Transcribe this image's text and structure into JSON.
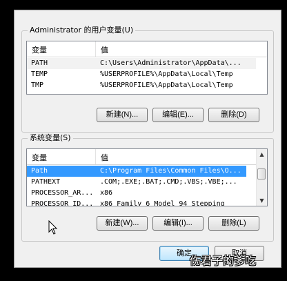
{
  "user_vars": {
    "title": "Administrator 的用户变量(U)",
    "headers": [
      "变量",
      "值"
    ],
    "rows": [
      {
        "name": "PATH",
        "value": "C:\\Users\\Administrator\\AppData\\..."
      },
      {
        "name": "TEMP",
        "value": "%USERPROFILE%\\AppData\\Local\\Temp"
      },
      {
        "name": "TMP",
        "value": "%USERPROFILE%\\AppData\\Local\\Temp"
      }
    ],
    "buttons": {
      "new": "新建(N)...",
      "edit": "编辑(E)...",
      "delete": "删除(D)"
    }
  },
  "system_vars": {
    "title": "系统变量(S)",
    "headers": [
      "变量",
      "值"
    ],
    "rows": [
      {
        "name": "Path",
        "value": "C:\\Program Files\\Common Files\\O..."
      },
      {
        "name": "PATHEXT",
        "value": ".COM;.EXE;.BAT;.CMD;.VBS;.VBE;..."
      },
      {
        "name": "PROCESSOR_AR...",
        "value": "x86"
      },
      {
        "name": "PROCESSOR_ID...",
        "value": "x86 Family 6 Model 94 Stepping"
      }
    ],
    "buttons": {
      "new": "新建(W)...",
      "edit": "编辑(I)...",
      "delete": "删除(L)"
    }
  },
  "footer": {
    "ok": "确定",
    "cancel": "取消"
  },
  "watermark": "伤君子的爹吃",
  "colors": {
    "selection": "#3399ff",
    "background": "#f0f0f0"
  }
}
